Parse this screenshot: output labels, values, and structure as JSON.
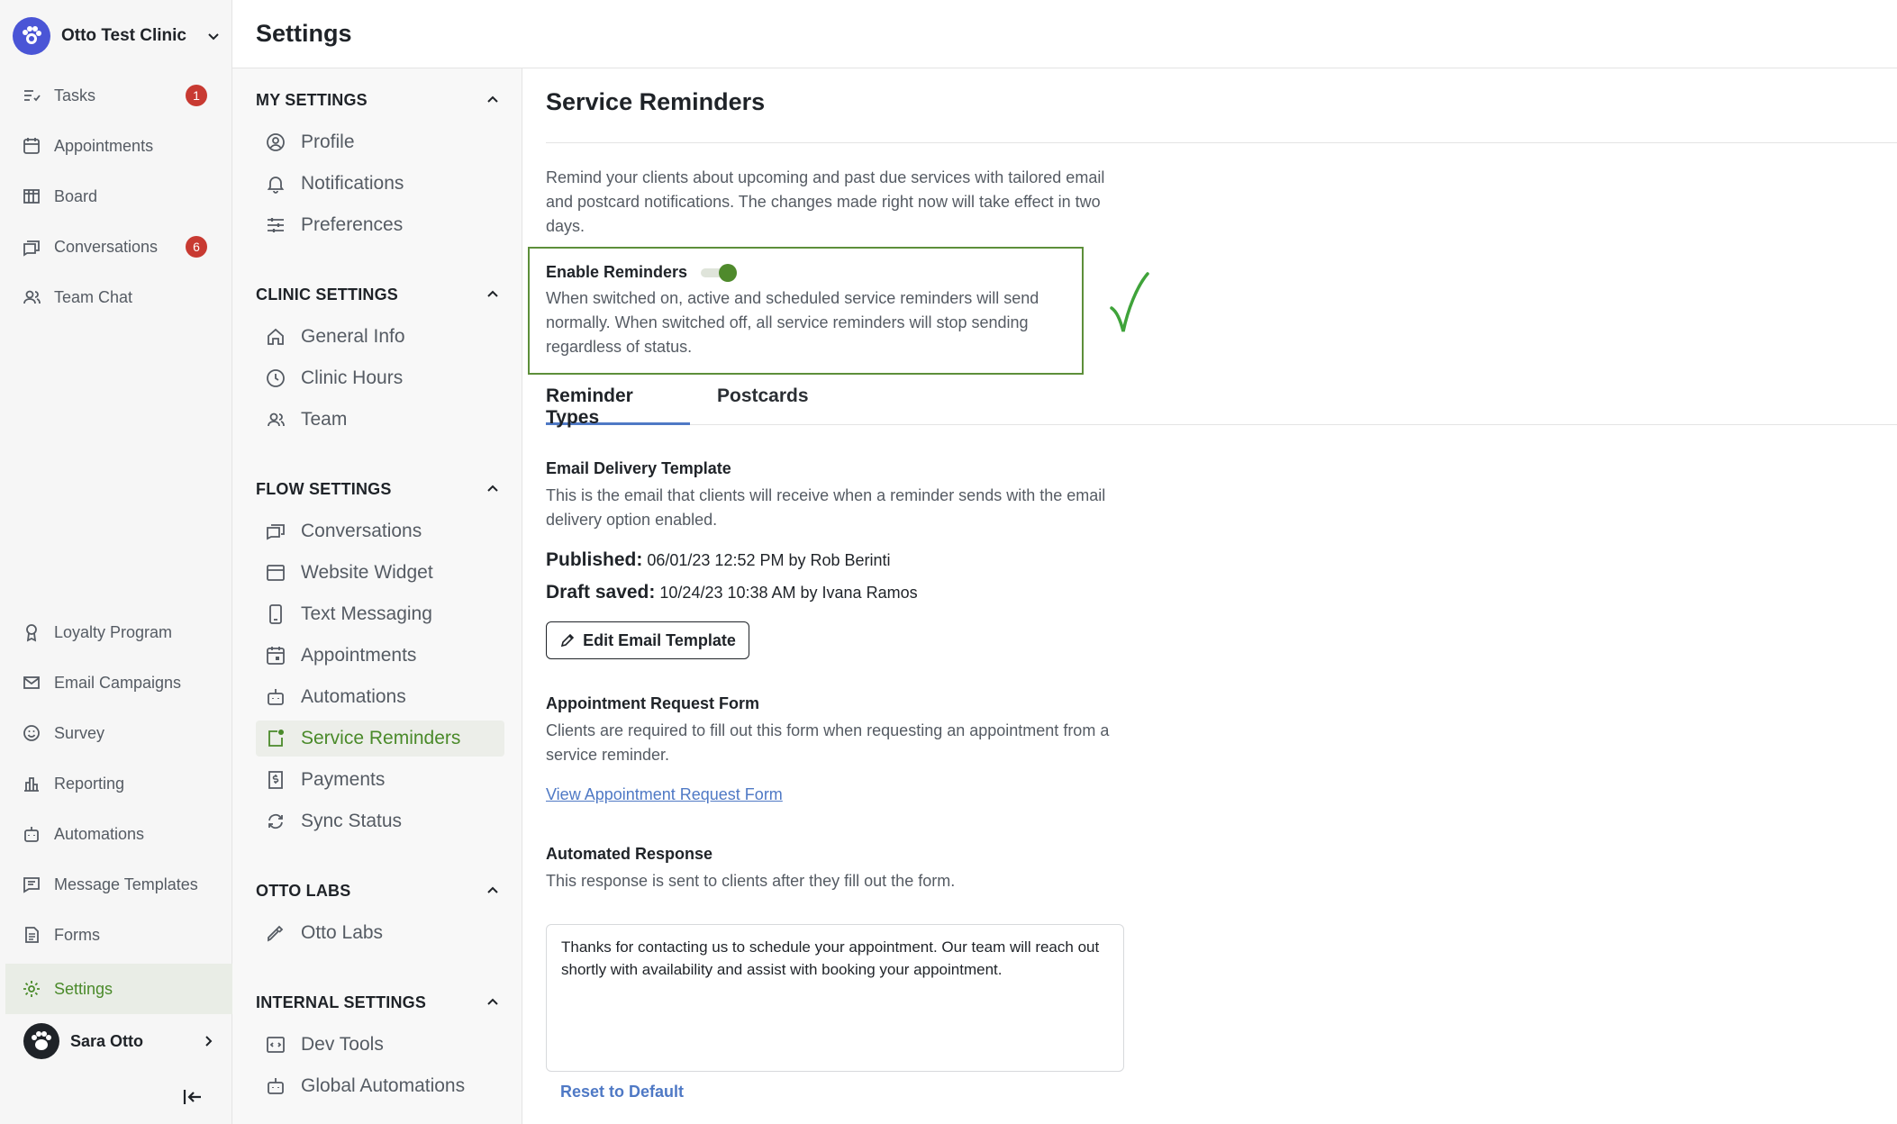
{
  "nav": {
    "clinic_name": "Otto Test Clinic",
    "items_top": [
      {
        "label": "Tasks",
        "icon": "tasks-icon",
        "badge": "1"
      },
      {
        "label": "Appointments",
        "icon": "calendar-icon",
        "badge": ""
      },
      {
        "label": "Board",
        "icon": "board-icon",
        "badge": ""
      },
      {
        "label": "Conversations",
        "icon": "chat-icon",
        "badge": "6"
      },
      {
        "label": "Team Chat",
        "icon": "team-icon",
        "badge": ""
      }
    ],
    "items_bottom": [
      {
        "label": "Loyalty Program",
        "icon": "award-icon"
      },
      {
        "label": "Email Campaigns",
        "icon": "mail-icon"
      },
      {
        "label": "Survey",
        "icon": "smile-icon"
      },
      {
        "label": "Reporting",
        "icon": "bar-chart-icon"
      },
      {
        "label": "Automations",
        "icon": "robot-icon"
      },
      {
        "label": "Message Templates",
        "icon": "message-template-icon"
      },
      {
        "label": "Forms",
        "icon": "form-icon"
      },
      {
        "label": "Settings",
        "icon": "gear-icon"
      }
    ],
    "user_name": "Sara Otto"
  },
  "header": {
    "title": "Settings"
  },
  "menu": {
    "sections": [
      {
        "title": "MY SETTINGS",
        "items": [
          "Profile",
          "Notifications",
          "Preferences"
        ]
      },
      {
        "title": "CLINIC SETTINGS",
        "items": [
          "General Info",
          "Clinic Hours",
          "Team"
        ]
      },
      {
        "title": "FLOW SETTINGS",
        "items": [
          "Conversations",
          "Website Widget",
          "Text Messaging",
          "Appointments",
          "Automations",
          "Service Reminders",
          "Payments",
          "Sync Status"
        ]
      },
      {
        "title": "OTTO LABS",
        "items": [
          "Otto Labs"
        ]
      },
      {
        "title": "INTERNAL SETTINGS",
        "items": [
          "Dev Tools",
          "Global Automations"
        ]
      }
    ],
    "active_item": "Service Reminders"
  },
  "content": {
    "title": "Service Reminders",
    "description": "Remind your clients about upcoming and past due services with tailored email and postcard notifications. The changes made right now will take effect in two days.",
    "enable_label": "Enable Reminders",
    "enable_on": true,
    "enable_description": "When switched on, active and scheduled service reminders will send normally. When switched off, all service reminders will stop sending regardless of status.",
    "tabs": [
      "Reminder Types",
      "Postcards"
    ],
    "email_template": {
      "heading": "Email Delivery Template",
      "description": "This is the email that clients will receive when a reminder sends with the email delivery option enabled.",
      "published_label": "Published:",
      "published_value": "06/01/23 12:52 PM by Rob Berinti",
      "draft_label": "Draft saved:",
      "draft_value": "10/24/23 10:38 AM by Ivana Ramos",
      "edit_button": "Edit Email Template"
    },
    "request_form": {
      "heading": "Appointment Request Form",
      "description": "Clients are required to fill out this form when requesting an appointment from a service reminder.",
      "link": "View Appointment Request Form"
    },
    "auto_response": {
      "heading": "Automated Response",
      "description": "This response is sent to clients after they fill out the form.",
      "text": "Thanks for contacting us to schedule your appointment. Our team will reach out shortly with availability and assist with booking your appointment.",
      "reset": "Reset to Default"
    }
  },
  "colors": {
    "accent_green": "#4a8a2a",
    "link_blue": "#4f79c5",
    "badge_red": "#c83a32",
    "brand_blue": "#4a55d6"
  }
}
